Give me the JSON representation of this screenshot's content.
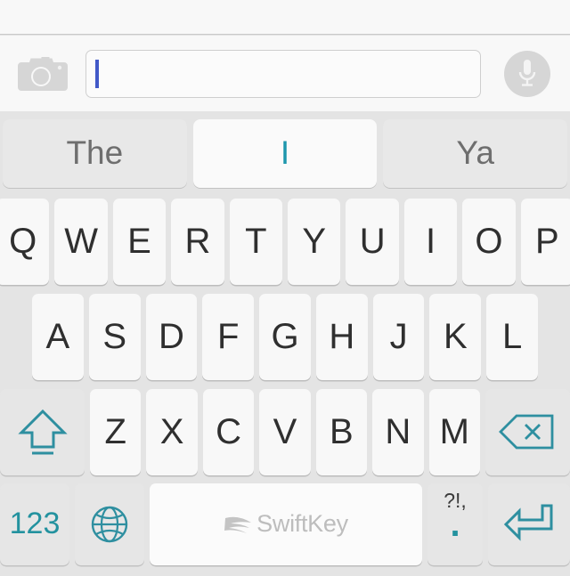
{
  "app": {
    "top_area_label": "message-area"
  },
  "input_bar": {
    "camera_icon": "camera-icon",
    "mic_icon": "microphone-icon",
    "text_field": {
      "value": "",
      "placeholder": "",
      "caret_color": "#4259c8"
    }
  },
  "suggestions": {
    "items": [
      {
        "label": "The",
        "primary": false
      },
      {
        "label": "I",
        "primary": true
      },
      {
        "label": "Ya",
        "primary": false
      }
    ],
    "primary_color": "#1d97ad"
  },
  "keyboard": {
    "accent_color": "#23929f",
    "key_text_color": "#2f2f2f",
    "rows": {
      "row1": [
        "Q",
        "W",
        "E",
        "R",
        "T",
        "Y",
        "U",
        "I",
        "O",
        "P"
      ],
      "row2": [
        "A",
        "S",
        "D",
        "F",
        "G",
        "H",
        "J",
        "K",
        "L"
      ],
      "row3_letters": [
        "Z",
        "X",
        "C",
        "V",
        "B",
        "N",
        "M"
      ],
      "shift_icon": "shift-icon",
      "backspace_icon": "backspace-icon"
    },
    "bottom_row": {
      "numbers_label": "123",
      "globe_icon": "globe-icon",
      "spacebar_brand": "SwiftKey",
      "punct_top_label": "?!,",
      "punct_main_label": ".",
      "enter_icon": "enter-icon"
    }
  }
}
